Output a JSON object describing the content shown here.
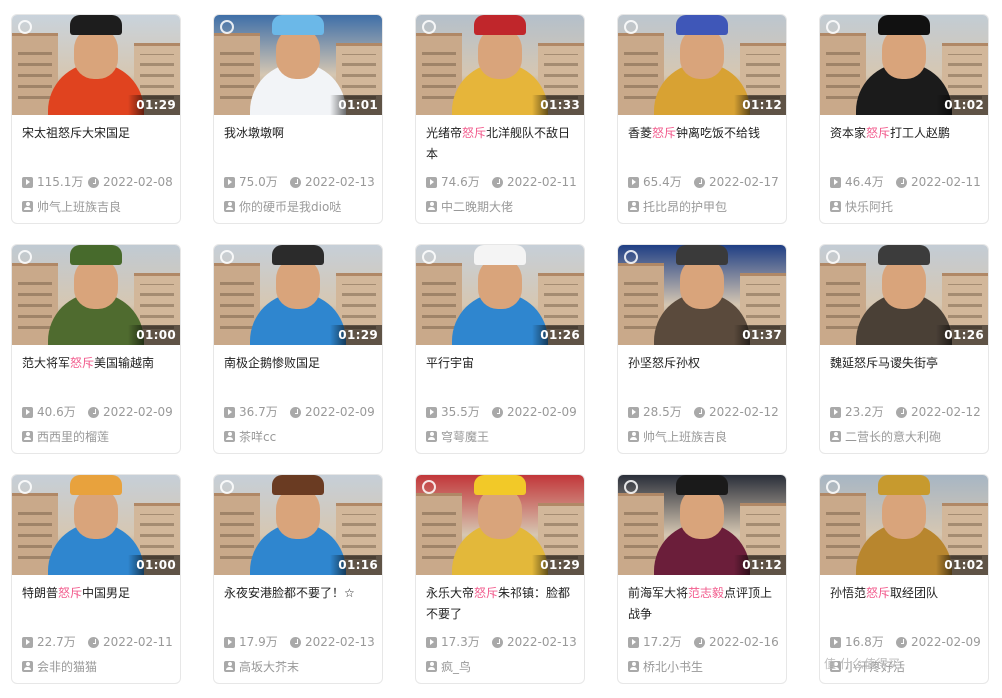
{
  "cards": [
    {
      "duration": "01:29",
      "title_parts": [
        {
          "t": "宋太祖怒斥大宋国足",
          "hl": false
        }
      ],
      "views": "115.1万",
      "date": "2022-02-08",
      "uploader": "帅气上班族吉良",
      "theme": {
        "body": "#e0431f",
        "hat": "#1d1d1d",
        "sky": "#c9d3dc"
      }
    },
    {
      "duration": "01:01",
      "title_parts": [
        {
          "t": "我冰墩墩啊",
          "hl": false
        }
      ],
      "views": "75.0万",
      "date": "2022-02-13",
      "uploader": "你的硬币是我dio哒",
      "theme": {
        "body": "#f2f4f7",
        "hat": "#6bb8e8",
        "sky": "#3f6fa8"
      }
    },
    {
      "duration": "01:33",
      "title_parts": [
        {
          "t": "光绪帝",
          "hl": false
        },
        {
          "t": "怒斥",
          "hl": true
        },
        {
          "t": "北洋舰队不敌日本",
          "hl": false
        }
      ],
      "views": "74.6万",
      "date": "2022-02-11",
      "uploader": "中二晚期大佬",
      "theme": {
        "body": "#e6b53a",
        "hat": "#c0262b",
        "sky": "#b4c0cb"
      }
    },
    {
      "duration": "01:12",
      "title_parts": [
        {
          "t": "香菱",
          "hl": false
        },
        {
          "t": "怒斥",
          "hl": true
        },
        {
          "t": "钟离吃饭不给钱",
          "hl": false
        }
      ],
      "views": "65.4万",
      "date": "2022-02-17",
      "uploader": "托比昂的护甲包",
      "theme": {
        "body": "#d8a233",
        "hat": "#3f57b8",
        "sky": "#bcc6cf"
      }
    },
    {
      "duration": "01:02",
      "title_parts": [
        {
          "t": "资本家",
          "hl": false
        },
        {
          "t": "怒斥",
          "hl": true
        },
        {
          "t": "打工人赵鹏",
          "hl": false
        }
      ],
      "views": "46.4万",
      "date": "2022-02-11",
      "uploader": "快乐阿托",
      "theme": {
        "body": "#1b1b1b",
        "hat": "#111111",
        "sky": "#c2ccd4"
      }
    },
    {
      "duration": "01:00",
      "title_parts": [
        {
          "t": "范大将军",
          "hl": false
        },
        {
          "t": "怒斥",
          "hl": true
        },
        {
          "t": "美国输越南",
          "hl": false
        }
      ],
      "views": "40.6万",
      "date": "2022-02-09",
      "uploader": "西西里的榴莲",
      "theme": {
        "body": "#4f6b2f",
        "hat": "#476a2c",
        "sky": "#c0cad3"
      }
    },
    {
      "duration": "01:29",
      "title_parts": [
        {
          "t": "南极企鹅惨败国足",
          "hl": false
        }
      ],
      "views": "36.7万",
      "date": "2022-02-09",
      "uploader": "茶咩cc",
      "theme": {
        "body": "#2f86cf",
        "hat": "#2b2b2b",
        "sky": "#c6cfd8"
      }
    },
    {
      "duration": "01:26",
      "title_parts": [
        {
          "t": "平行宇宙",
          "hl": false
        }
      ],
      "views": "35.5万",
      "date": "2022-02-09",
      "uploader": "穹萼魔王",
      "theme": {
        "body": "#2f86cf",
        "hat": "#f4f4f4",
        "sky": "#c6cfd8"
      }
    },
    {
      "duration": "01:37",
      "title_parts": [
        {
          "t": "孙坚怒斥孙权",
          "hl": false
        }
      ],
      "views": "28.5万",
      "date": "2022-02-12",
      "uploader": "帅气上班族吉良",
      "theme": {
        "body": "#5a4a3c",
        "hat": "#3a3a3a",
        "sky": "#1f3f85"
      }
    },
    {
      "duration": "01:26",
      "title_parts": [
        {
          "t": "魏延怒斥马谡失街亭",
          "hl": false
        }
      ],
      "views": "23.2万",
      "date": "2022-02-12",
      "uploader": "二营长的意大利砲",
      "theme": {
        "body": "#4a4036",
        "hat": "#3c3c3c",
        "sky": "#c3ccd5"
      }
    },
    {
      "duration": "01:00",
      "title_parts": [
        {
          "t": "特朗普",
          "hl": false
        },
        {
          "t": "怒斥",
          "hl": true
        },
        {
          "t": "中国男足",
          "hl": false
        }
      ],
      "views": "22.7万",
      "date": "2022-02-11",
      "uploader": "会非的猫猫",
      "theme": {
        "body": "#2f86cf",
        "hat": "#e8a23d",
        "sky": "#c6cfd8"
      }
    },
    {
      "duration": "01:16",
      "title_parts": [
        {
          "t": "永夜安港脸都不要了！☆",
          "hl": false
        }
      ],
      "views": "17.9万",
      "date": "2022-02-13",
      "uploader": "高坂大芥末",
      "theme": {
        "body": "#2f86cf",
        "hat": "#6a3b22",
        "sky": "#c6cfd8"
      }
    },
    {
      "duration": "01:29",
      "title_parts": [
        {
          "t": "永乐大帝",
          "hl": false
        },
        {
          "t": "怒斥",
          "hl": true
        },
        {
          "t": "朱祁镇：脸都不要了",
          "hl": false
        }
      ],
      "views": "17.3万",
      "date": "2022-02-13",
      "uploader": "疯_鸟",
      "theme": {
        "body": "#e3b83a",
        "hat": "#f2c928",
        "sky": "#c2373a"
      }
    },
    {
      "duration": "01:12",
      "title_parts": [
        {
          "t": "前海军大将",
          "hl": false
        },
        {
          "t": "范志毅",
          "hl": true
        },
        {
          "t": "点评顶上战争",
          "hl": false
        }
      ],
      "views": "17.2万",
      "date": "2022-02-16",
      "uploader": "桥北小书生",
      "theme": {
        "body": "#6b1e3a",
        "hat": "#1a1a1a",
        "sky": "#2a2f3a"
      }
    },
    {
      "duration": "01:02",
      "title_parts": [
        {
          "t": "孙悟范",
          "hl": false
        },
        {
          "t": "怒斥",
          "hl": true
        },
        {
          "t": "取经团队",
          "hl": false
        }
      ],
      "views": "16.8万",
      "date": "2022-02-09",
      "uploader": "小汗疼好活",
      "theme": {
        "body": "#b8862e",
        "hat": "#c79a2e",
        "sky": "#a7b6c4"
      }
    }
  ],
  "watermark": "值 什么值得买"
}
